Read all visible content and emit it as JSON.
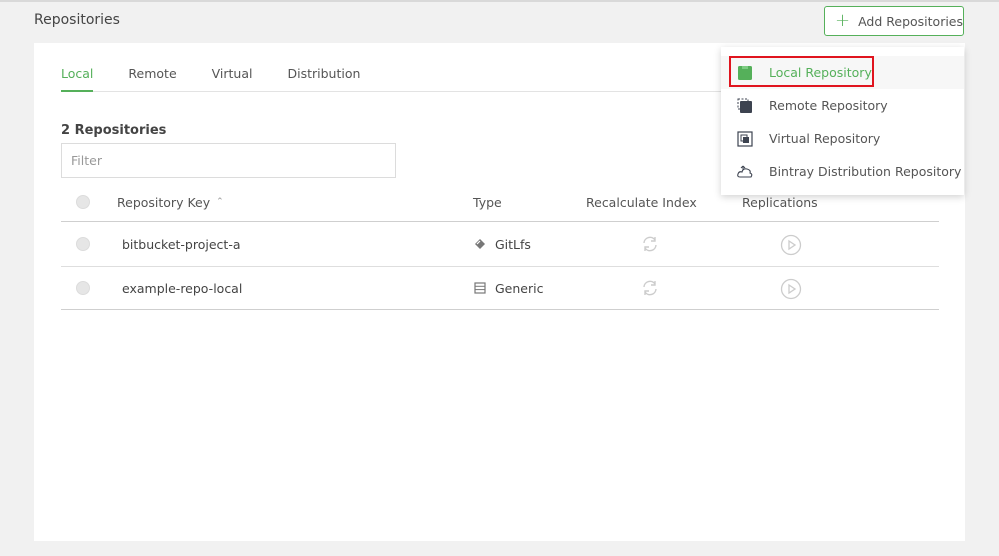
{
  "header": {
    "title": "Repositories",
    "add_button_label": "Add Repositories",
    "add_icon": "plus-icon"
  },
  "tabs": [
    {
      "label": "Local",
      "active": true
    },
    {
      "label": "Remote",
      "active": false
    },
    {
      "label": "Virtual",
      "active": false
    },
    {
      "label": "Distribution",
      "active": false
    }
  ],
  "repo_count": "2 Repositories",
  "filter": {
    "placeholder": "Filter",
    "value": ""
  },
  "table": {
    "columns": [
      "Repository Key",
      "Type",
      "Recalculate Index",
      "Replications"
    ],
    "sort_icon": "chevron-up-icon",
    "rows": [
      {
        "key": "bitbucket-project-a",
        "type": "GitLfs",
        "type_icon": "gitlfs-icon"
      },
      {
        "key": "example-repo-local",
        "type": "Generic",
        "type_icon": "generic-icon"
      }
    ]
  },
  "dropdown": {
    "items": [
      {
        "label": "Local Repository",
        "icon": "local-repo-icon"
      },
      {
        "label": "Remote Repository",
        "icon": "remote-repo-icon"
      },
      {
        "label": "Virtual Repository",
        "icon": "virtual-repo-icon"
      },
      {
        "label": "Bintray Distribution Repository",
        "icon": "distribution-repo-icon"
      }
    ]
  },
  "colors": {
    "accent": "#55b05a",
    "highlight": "#e0141e"
  }
}
